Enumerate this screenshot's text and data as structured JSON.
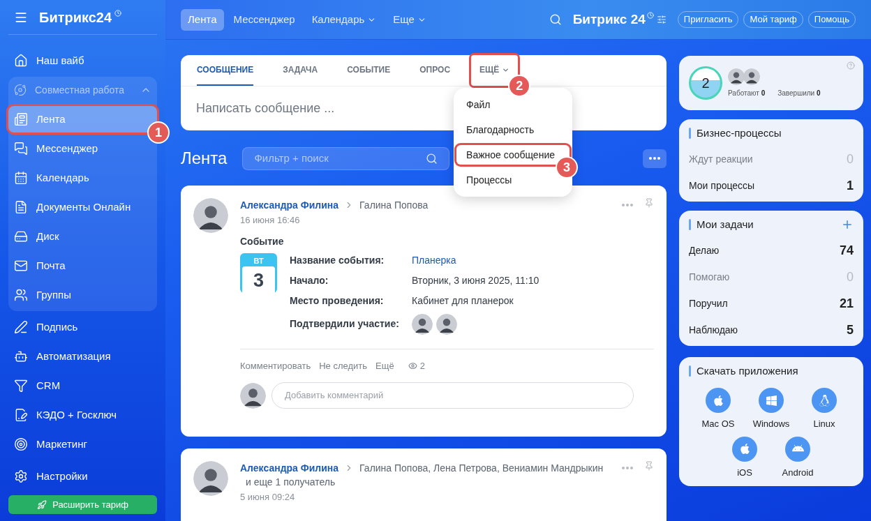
{
  "sidebar": {
    "logo": "Битрикс24",
    "items": [
      {
        "kind": "link",
        "label": "Наш вайб",
        "selected": false
      },
      {
        "kind": "group",
        "label": "Совместная работа",
        "expanded": true,
        "children": [
          {
            "label": "Лента",
            "selected": true,
            "callout": "1"
          },
          {
            "label": "Мессенджер",
            "selected": false
          },
          {
            "label": "Календарь",
            "selected": false
          },
          {
            "label": "Документы Онлайн",
            "selected": false
          },
          {
            "label": "Диск",
            "selected": false
          },
          {
            "label": "Почта",
            "selected": false
          },
          {
            "label": "Группы",
            "selected": false
          }
        ]
      },
      {
        "kind": "link",
        "label": "Подпись",
        "selected": false
      },
      {
        "kind": "link",
        "label": "Автоматизация",
        "selected": false
      },
      {
        "kind": "link",
        "label": "CRM",
        "selected": false
      },
      {
        "kind": "link",
        "label": "КЭДО + Госключ",
        "selected": false
      },
      {
        "kind": "link",
        "label": "Маркетинг",
        "selected": false
      }
    ],
    "settings": "Настройки",
    "upgrade_button": "Расширить тариф"
  },
  "topbar": {
    "tabs": [
      {
        "label": "Лента",
        "selected": true,
        "dropdown": false
      },
      {
        "label": "Мессенджер",
        "selected": false,
        "dropdown": false
      },
      {
        "label": "Календарь",
        "selected": false,
        "dropdown": true
      },
      {
        "label": "Еще",
        "selected": false,
        "dropdown": true
      }
    ],
    "brand": "Битрикс 24",
    "buttons": [
      "Пригласить",
      "Мой тариф",
      "Помощь"
    ]
  },
  "composer": {
    "tabs": [
      {
        "label": "СООБЩЕНИЕ",
        "selected": true,
        "dropdown": false
      },
      {
        "label": "ЗАДАЧА",
        "selected": false,
        "dropdown": false
      },
      {
        "label": "СОБЫТИЕ",
        "selected": false,
        "dropdown": false
      },
      {
        "label": "ОПРОС",
        "selected": false,
        "dropdown": false
      },
      {
        "label": "ЕЩЁ",
        "selected": false,
        "dropdown": true,
        "callout": "2"
      }
    ],
    "placeholder": "Написать сообщение ...",
    "menu": [
      {
        "label": "Файл"
      },
      {
        "label": "Благодарность"
      },
      {
        "label": "Важное сообщение",
        "callout": "3"
      },
      {
        "label": "Процессы"
      }
    ]
  },
  "feed": {
    "title": "Лента",
    "search_placeholder": "Фильтр + поиск",
    "posts": [
      {
        "author": "Александра Филина",
        "recipients": "Галина Попова",
        "date": "16 июня 16:46",
        "type": "Событие",
        "calendar": {
          "weekday": "ВТ",
          "day": "3"
        },
        "fields": [
          {
            "kind": "link",
            "label": "Название события:",
            "value": "Планерка"
          },
          {
            "kind": "text",
            "label": "Начало:",
            "value": "Вторник, 3 июня 2025, 11:10"
          },
          {
            "kind": "text",
            "label": "Место проведения:",
            "value": "Кабинет для планерок"
          },
          {
            "kind": "avatars",
            "label": "Подтвердили участие:"
          }
        ],
        "actions": [
          "Комментировать",
          "Не следить",
          "Ещё"
        ],
        "views": "2",
        "comment_placeholder": "Добавить комментарий"
      },
      {
        "author": "Александра Филина",
        "recipients": "Галина Попова, Лена Петрова, Вениамин Мандрыкин",
        "more_recipients": "и еще 1 получатель",
        "date": "5 июня 09:24"
      }
    ]
  },
  "right": {
    "presence": {
      "count": "2",
      "stats": [
        {
          "label": "Работают",
          "value": "0"
        },
        {
          "label": "Завершили",
          "value": "0"
        }
      ]
    },
    "processes": {
      "title": "Бизнес-процессы",
      "rows": [
        {
          "label": "Ждут реакции",
          "value": "0",
          "muted": true
        },
        {
          "label": "Мои процессы",
          "value": "1",
          "muted": false
        }
      ]
    },
    "tasks": {
      "title": "Мои задачи",
      "rows": [
        {
          "label": "Делаю",
          "value": "74",
          "muted": false
        },
        {
          "label": "Помогаю",
          "value": "0",
          "muted": true
        },
        {
          "label": "Поручил",
          "value": "21",
          "muted": false
        },
        {
          "label": "Наблюдаю",
          "value": "5",
          "muted": false
        }
      ]
    },
    "apps": {
      "title": "Скачать приложения",
      "items": [
        {
          "label": "Mac OS"
        },
        {
          "label": "Windows"
        },
        {
          "label": "Linux"
        },
        {
          "label": "iOS"
        },
        {
          "label": "Android"
        }
      ]
    }
  }
}
